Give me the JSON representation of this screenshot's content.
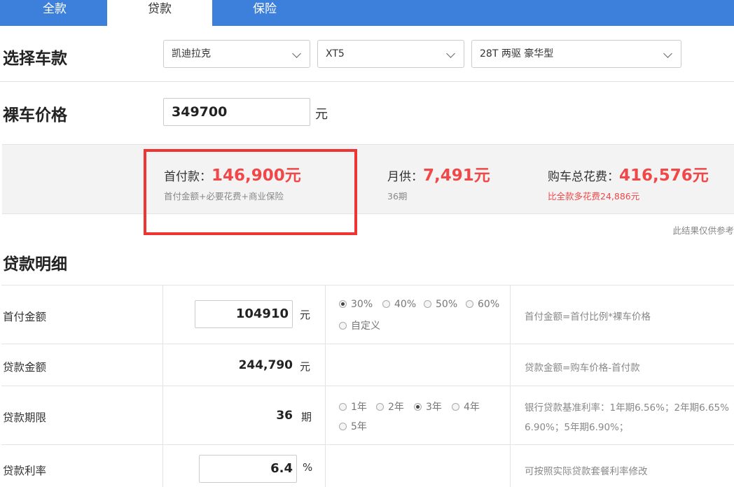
{
  "tabs": [
    "全款",
    "贷款",
    "保险"
  ],
  "select_car": {
    "title": "选择车款",
    "brand": "凯迪拉克",
    "model": "XT5",
    "trim": "28T 两驱 豪华型"
  },
  "price": {
    "title": "裸车价格",
    "value": "349700",
    "unit": "元"
  },
  "summary": {
    "down_label": "首付款：",
    "down_value": "146,900元",
    "down_sub": "首付金额+必要花费+商业保险",
    "monthly_label": "月供：",
    "monthly_value": "7,491元",
    "monthly_sub": "36期",
    "total_label": "购车总花费：",
    "total_value": "416,576元",
    "total_sub": "比全款多花费24,886元",
    "note": "此结果仅供参考"
  },
  "detail": {
    "title": "贷款明细",
    "down_payment": {
      "label": "首付金额",
      "value": "104910",
      "unit": "元",
      "options": [
        "30%",
        "40%",
        "50%",
        "60%",
        "自定义"
      ],
      "selected": "30%",
      "hint": "首付金额=首付比例*裸车价格"
    },
    "loan_amount": {
      "label": "贷款金额",
      "value": "244,790",
      "unit": "元",
      "hint": "贷款金额=购车价格-首付款"
    },
    "term": {
      "label": "贷款期限",
      "value": "36",
      "unit": "期",
      "options": [
        "1年",
        "2年",
        "3年",
        "4年",
        "5年"
      ],
      "selected": "3年",
      "hint_line1": "银行贷款基准利率：1年期6.56%；2年期6.65%",
      "hint_line2": "6.90%；5年期6.90%；"
    },
    "rate": {
      "label": "贷款利率",
      "value": "6.4",
      "unit": "%",
      "hint": "可按照实际贷款套餐利率修改"
    }
  },
  "colors": {
    "tab_bar": "#3d80dc",
    "accent_red": "#f04848",
    "highlight_border": "#ef3434"
  }
}
